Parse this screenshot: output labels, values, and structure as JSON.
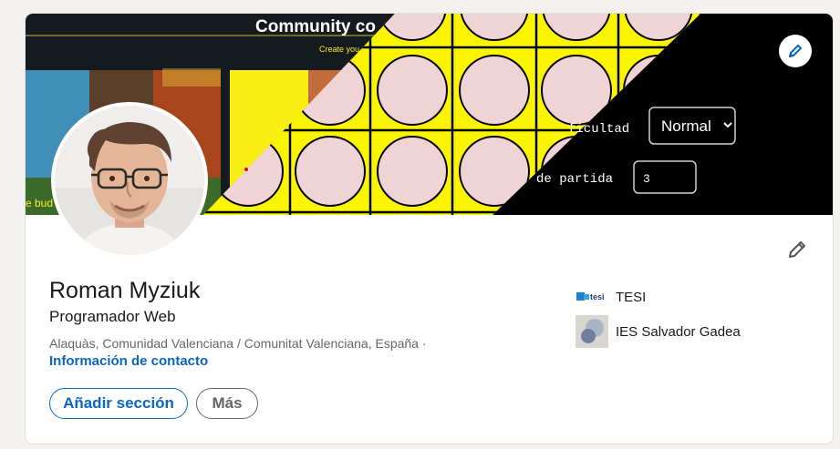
{
  "banner": {
    "title_text": "Community co",
    "subtitle_text": "Create you",
    "side_text": "e bud",
    "difficulty_label": "ficultad",
    "difficulty_value": "Normal",
    "match_label": "de partida",
    "match_value": "3"
  },
  "profile": {
    "name": "Roman Myziuk",
    "headline": "Programador Web",
    "location": "Alaquàs, Comunidad Valenciana / Comunitat Valenciana, España ·",
    "contact_link": "Información de contacto"
  },
  "actions": {
    "add_section": "Añadir sección",
    "more": "Más"
  },
  "organizations": [
    {
      "name": "TESI",
      "logo_text": "tesi"
    },
    {
      "name": "IES Salvador Gadea"
    }
  ],
  "colors": {
    "accent": "#0a66c2",
    "banner_yellow": "#fbf400",
    "disc_pink": "#efd3d5",
    "banner_dark": "#000000"
  }
}
